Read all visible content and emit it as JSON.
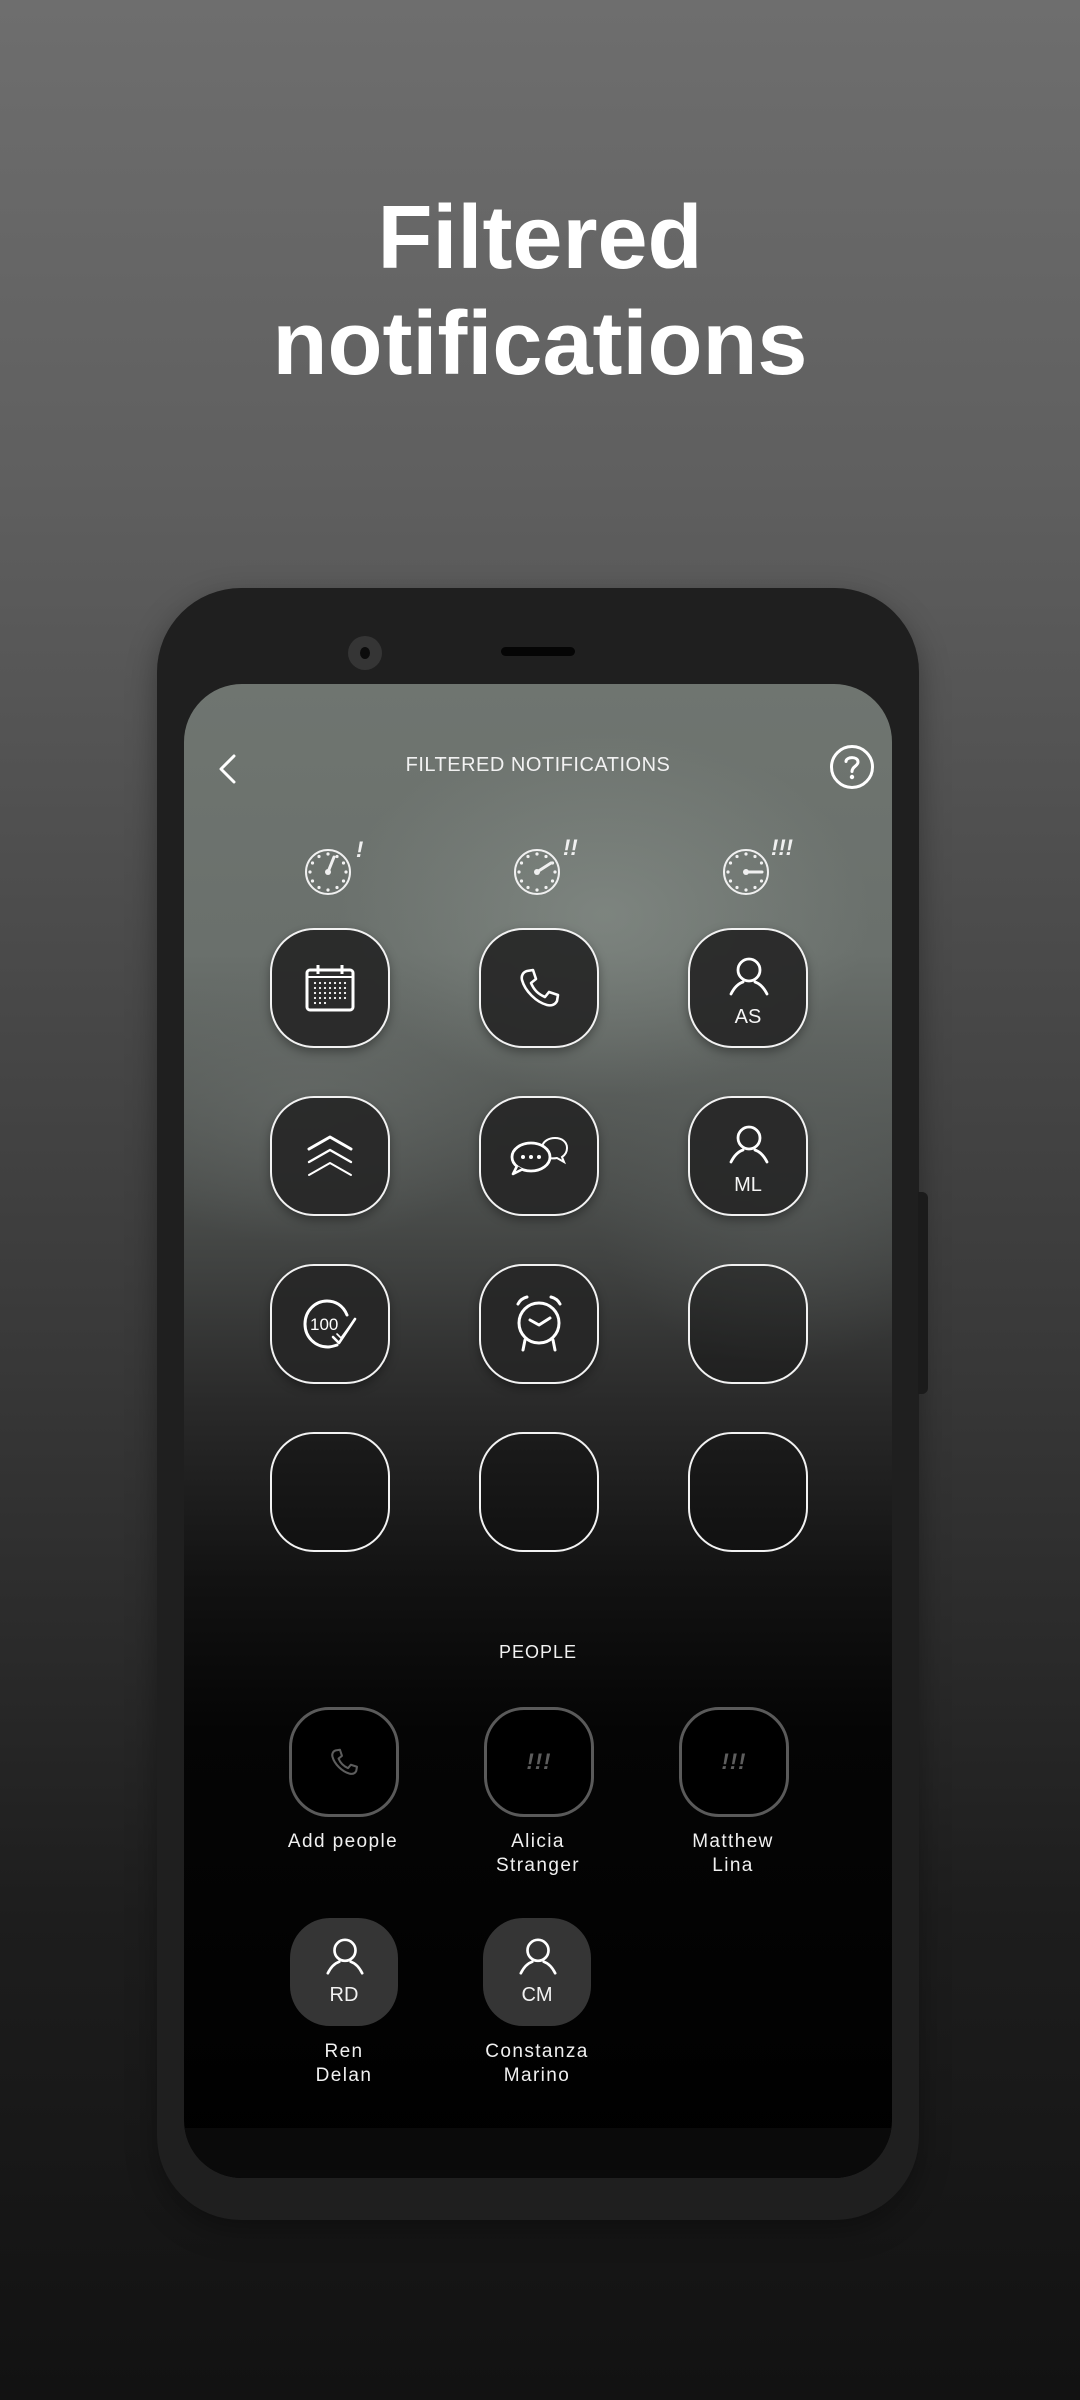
{
  "promo": {
    "headline_line1": "Filtered",
    "headline_line2": "notifications"
  },
  "header": {
    "title": "FILTERED NOTIFICATIONS",
    "back_icon": "chevron-left-icon",
    "help_icon": "help-circle-icon"
  },
  "priority_levels": [
    {
      "icon": "gauge-low-icon",
      "marker": "!"
    },
    {
      "icon": "gauge-medium-icon",
      "marker": "!!"
    },
    {
      "icon": "gauge-high-icon",
      "marker": "!!!"
    }
  ],
  "filter_grid": [
    {
      "icon": "calendar-icon",
      "initials": ""
    },
    {
      "icon": "phone-icon",
      "initials": ""
    },
    {
      "icon": "person-icon",
      "initials": "AS"
    },
    {
      "icon": "chevrons-up-icon",
      "initials": ""
    },
    {
      "icon": "chat-bubbles-icon",
      "initials": ""
    },
    {
      "icon": "person-icon",
      "initials": "ML"
    },
    {
      "icon": "hundred-check-icon",
      "initials": ""
    },
    {
      "icon": "alarm-clock-icon",
      "initials": ""
    },
    {
      "icon": "empty-slot",
      "initials": ""
    },
    {
      "icon": "empty-slot",
      "initials": ""
    },
    {
      "icon": "empty-slot",
      "initials": ""
    },
    {
      "icon": "empty-slot",
      "initials": ""
    }
  ],
  "people": {
    "section_label": "PEOPLE",
    "items": [
      {
        "name_line1": "Add people",
        "name_line2": "",
        "icon": "phone-icon",
        "badge": ""
      },
      {
        "name_line1": "Alicia",
        "name_line2": "Stranger",
        "icon": "priority-icon",
        "badge": "!!!"
      },
      {
        "name_line1": "Matthew",
        "name_line2": "Lina",
        "icon": "priority-icon",
        "badge": "!!!"
      },
      {
        "name_line1": "Ren",
        "name_line2": "Delan",
        "icon": "person-icon",
        "initials": "RD"
      },
      {
        "name_line1": "Constanza",
        "name_line2": "Marino",
        "icon": "person-icon",
        "initials": "CM"
      }
    ]
  }
}
